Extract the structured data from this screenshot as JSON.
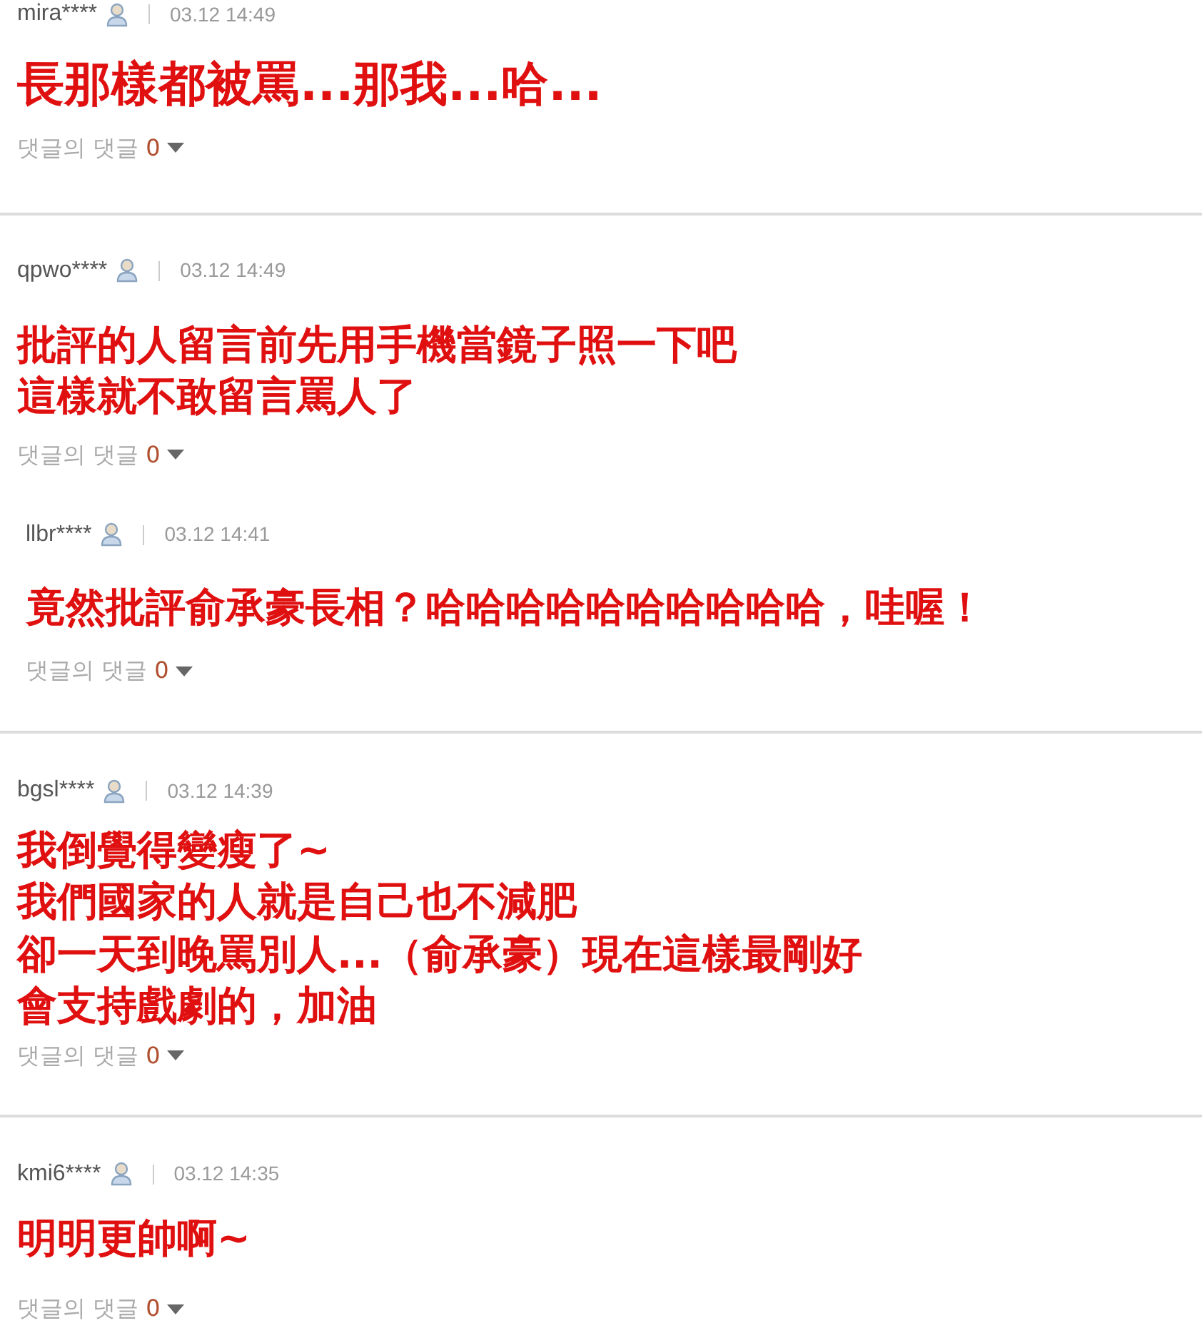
{
  "comments": [
    {
      "user": "mira****",
      "time": "03.12 14:49",
      "kind": "headline",
      "nested": false,
      "lines": [
        "長那樣都被罵...那我...哈..."
      ],
      "reply_label": "댓글의 댓글",
      "reply_count": "0"
    },
    {
      "user": "qpwo****",
      "time": "03.12 14:49",
      "kind": "body",
      "nested": false,
      "lines": [
        "批評的人留言前先用手機當鏡子照一下吧",
        "這樣就不敢留言罵人了"
      ],
      "reply_label": "댓글의 댓글",
      "reply_count": "0"
    },
    {
      "user": "llbr****",
      "time": "03.12 14:41",
      "kind": "body",
      "nested": true,
      "lines": [
        "竟然批評俞承豪長相？哈哈哈哈哈哈哈哈哈哈，哇喔！"
      ],
      "reply_label": "댓글의 댓글",
      "reply_count": "0"
    },
    {
      "user": "bgsl****",
      "time": "03.12 14:39",
      "kind": "body",
      "nested": false,
      "lines": [
        "我倒覺得變瘦了~",
        "我們國家的人就是自己也不減肥",
        "卻一天到晚罵別人...（俞承豪）現在這樣最剛好",
        "會支持戲劇的，加油"
      ],
      "reply_label": "댓글의 댓글",
      "reply_count": "0"
    },
    {
      "user": "kmi6****",
      "time": "03.12 14:35",
      "kind": "body",
      "nested": false,
      "lines": [
        "明明更帥啊~"
      ],
      "reply_label": "댓글의 댓글",
      "reply_count": "0"
    }
  ]
}
